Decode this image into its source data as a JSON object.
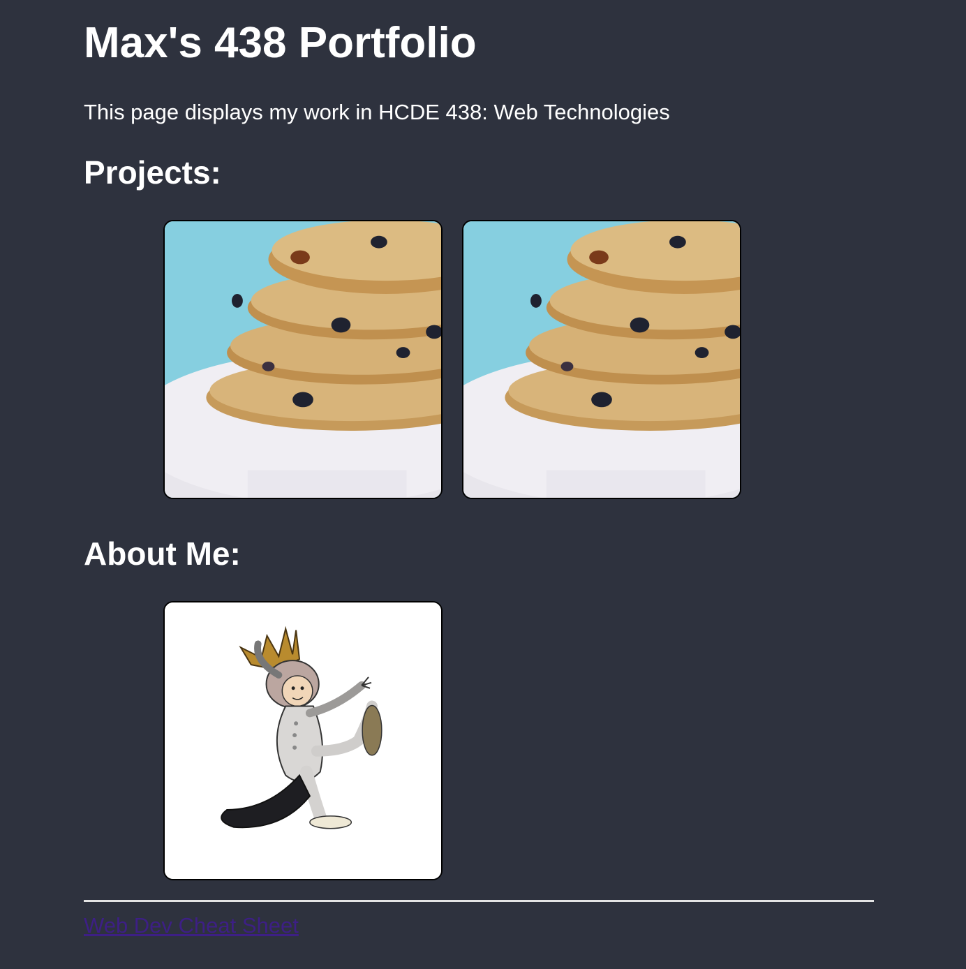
{
  "header": {
    "title": "Max's 438 Portfolio",
    "intro": "This page displays my work in HCDE 438: Web Technologies"
  },
  "projects": {
    "heading": "Projects:",
    "items": [
      {
        "image": "oatmeal-raisin-cookies-image"
      },
      {
        "image": "oatmeal-raisin-cookies-image"
      }
    ]
  },
  "about": {
    "heading": "About Me:",
    "image": "wild-thing-king-illustration"
  },
  "footer": {
    "link_label": "Web Dev Cheat Sheet"
  },
  "colors": {
    "background": "#2e323e",
    "text": "#ffffff",
    "link": "#3d1f85",
    "divider": "#e4e4e4"
  }
}
